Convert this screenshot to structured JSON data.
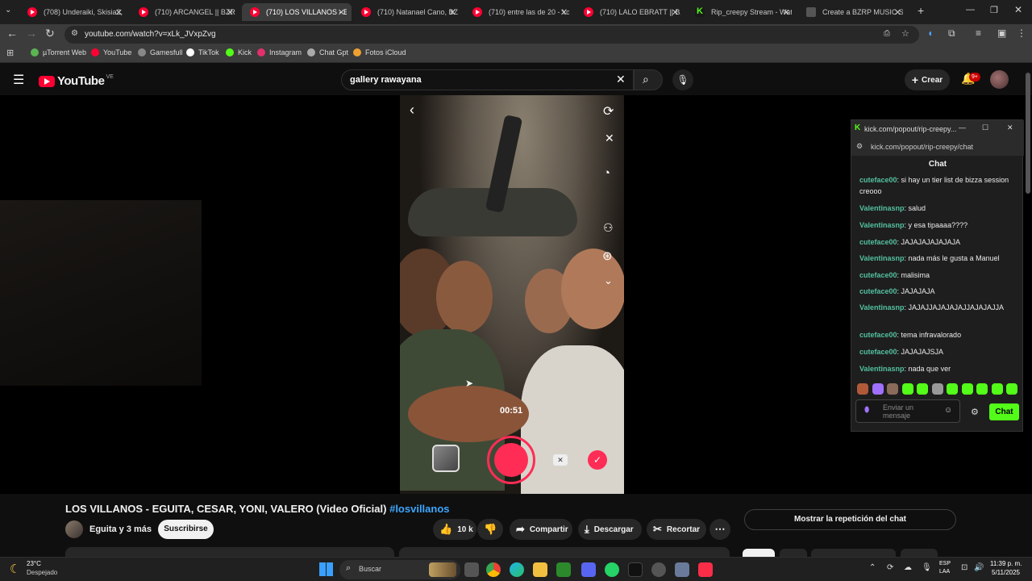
{
  "browser": {
    "tabs": [
      {
        "label": "(708) Underaiki, Skisia2, I",
        "icon": "youtube"
      },
      {
        "label": "(710) ARCANGEL || BZRP",
        "icon": "youtube"
      },
      {
        "label": "(710) LOS VILLANOS - EG",
        "icon": "youtube",
        "active": true
      },
      {
        "label": "(710) Natanael Cano, BZR",
        "icon": "youtube"
      },
      {
        "label": "(710) entre las de 20 - Yo",
        "icon": "youtube"
      },
      {
        "label": "(710) LALO EBRATT || BZR",
        "icon": "youtube"
      },
      {
        "label": "Rip_creepy Stream - Wat",
        "icon": "kick"
      },
      {
        "label": "Create a BZRP MUSIC SE",
        "icon": "bzrp"
      }
    ],
    "new_tab": "+",
    "url": "youtube.com/watch?v=xLk_JVxpZvg",
    "bookmarks": [
      {
        "label": "µTorrent Web",
        "color": "#5ab552"
      },
      {
        "label": "YouTube",
        "color": "#ff0033"
      },
      {
        "label": "Gamesfull",
        "color": "#888888"
      },
      {
        "label": "TikTok",
        "color": "#ffffff"
      },
      {
        "label": "Kick",
        "color": "#53fc18"
      },
      {
        "label": "Instagram",
        "color": "#e1306c"
      },
      {
        "label": "Chat Gpt",
        "color": "#aaaaaa"
      },
      {
        "label": "Fotos iCloud",
        "color": "#f0a030"
      }
    ]
  },
  "youtube": {
    "logo": "YouTube",
    "country": "VE",
    "search_value": "gallery rawayana",
    "create_label": "Crear",
    "notif_badge": "9+"
  },
  "video": {
    "timer": "00:51"
  },
  "kick": {
    "title": "kick.com/popout/rip-creepy...",
    "url": "kick.com/popout/rip-creepy/chat",
    "header": "Chat",
    "messages": [
      {
        "user": "cuteface00",
        "text": ": si hay un tier list de bizza session creooo"
      },
      {
        "user": "Valentinasnp",
        "text": ": salud"
      },
      {
        "user": "Valentinasnp",
        "text": ": y esa tipaaaa????"
      },
      {
        "user": "cuteface00",
        "text": ": JAJAJAJAJAJAJA"
      },
      {
        "user": "Valentinasnp",
        "text": ": nada más le gusta a Manuel"
      },
      {
        "user": "cuteface00",
        "text": ": malisima"
      },
      {
        "user": "cuteface00",
        "text": ": JAJAJAJA"
      },
      {
        "user": "Valentinasnp",
        "text": ": JAJAJJAJAJAJAJJAJAJAJJA"
      },
      {
        "user": "cuteface00",
        "text": ": tema infravalorado"
      },
      {
        "user": "cuteface00",
        "text": ": JAJAJAJSJA"
      },
      {
        "user": "Valentinasnp",
        "text": ": nada que ver"
      }
    ],
    "input_placeholder": "Enviar un mensaje",
    "send_label": "Chat"
  },
  "below": {
    "title": "LOS VILLANOS - EGUITA, CESAR, YONI, VALERO (Video Oficial)",
    "hashtag": "#losvillanos",
    "channel": "Eguita y 3 más",
    "subscribe": "Suscribirse",
    "likes": "10 k",
    "share": "Compartir",
    "download": "Descargar",
    "clip": "Recortar",
    "replay_chat": "Mostrar la repetición del chat"
  },
  "taskbar": {
    "weather_temp": "23°C",
    "weather_desc": "Despejado",
    "search": "Buscar",
    "lang1": "ESP",
    "lang2": "LAA",
    "time": "11:39 p. m.",
    "date": "5/11/2025"
  }
}
